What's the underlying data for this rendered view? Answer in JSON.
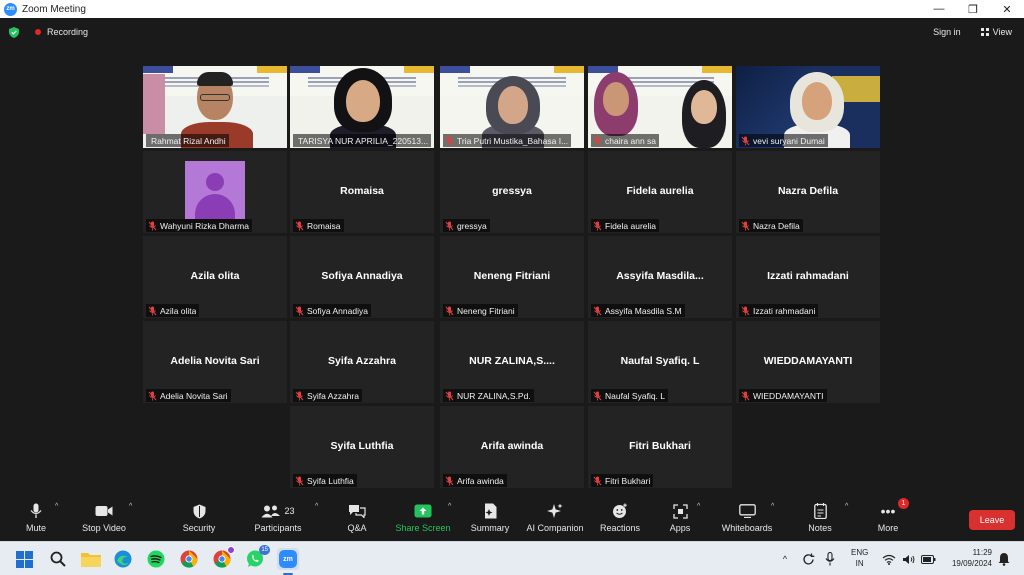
{
  "window": {
    "app_title": "Zoom Meeting",
    "minimize": "—",
    "maximize": "❐",
    "close": "✕"
  },
  "topbar": {
    "recording_label": "Recording",
    "sign_in_label": "Sign in",
    "view_label": "View"
  },
  "colors": {
    "accent_green": "#25c35e",
    "recording_red": "#e02828",
    "leave_red": "#d93030",
    "active_speaker": "#e9d94a",
    "avatar_purple": "#b478d6"
  },
  "participants": [
    {
      "display_name": "Rahmat Rizal Andhi",
      "video_on": true,
      "muted": false
    },
    {
      "display_name": "TARISYA NUR APRILIA_220513...",
      "video_on": true,
      "muted": false,
      "active_speaker": true
    },
    {
      "display_name": "Tria Putri Mustika_Bahasa I...",
      "video_on": true,
      "muted": true
    },
    {
      "display_name": "chaira ann sa",
      "video_on": true,
      "muted": true
    },
    {
      "display_name": "vevi suryani Dumai",
      "video_on": true,
      "muted": true
    },
    {
      "display_name": "Wahyuni Rizka Dharma",
      "video_on": false,
      "muted": true,
      "avatar": "person-avatar-icon"
    },
    {
      "center_name": "Romaisa",
      "display_name": "Romaisa",
      "video_on": false,
      "muted": true
    },
    {
      "center_name": "gressya",
      "display_name": "gressya",
      "video_on": false,
      "muted": true
    },
    {
      "center_name": "Fidela aurelia",
      "display_name": "Fidela aurelia",
      "video_on": false,
      "muted": true
    },
    {
      "center_name": "Nazra Defila",
      "display_name": "Nazra Defila",
      "video_on": false,
      "muted": true
    },
    {
      "center_name": "Azila olita",
      "display_name": "Azila olita",
      "video_on": false,
      "muted": true
    },
    {
      "center_name": "Sofiya Annadiya",
      "display_name": "Sofiya Annadiya",
      "video_on": false,
      "muted": true
    },
    {
      "center_name": "Neneng Fitriani",
      "display_name": "Neneng Fitriani",
      "video_on": false,
      "muted": true
    },
    {
      "center_name": "Assyifa  Masdila...",
      "display_name": "Assyifa Masdila S.M",
      "video_on": false,
      "muted": true
    },
    {
      "center_name": "Izzati rahmadani",
      "display_name": "Izzati rahmadani",
      "video_on": false,
      "muted": true
    },
    {
      "center_name": "Adelia Novita Sari",
      "display_name": "Adelia Novita Sari",
      "video_on": false,
      "muted": true
    },
    {
      "center_name": "Syifa Azzahra",
      "display_name": "Syifa Azzahra",
      "video_on": false,
      "muted": true
    },
    {
      "center_name": "NUR  ZALINA,S....",
      "display_name": "NUR ZALINA,S.Pd.",
      "video_on": false,
      "muted": true
    },
    {
      "center_name": "Naufal Syafiq. L",
      "display_name": "Naufal Syafiq. L",
      "video_on": false,
      "muted": true
    },
    {
      "center_name": "WIEDDAMAYANTI",
      "display_name": "WIEDDAMAYANTI",
      "video_on": false,
      "muted": true
    },
    {
      "center_name": "Syifa Luthfia",
      "display_name": "Syifa Luthfia",
      "video_on": false,
      "muted": true
    },
    {
      "center_name": "Arifa awinda",
      "display_name": "Arifa awinda",
      "video_on": false,
      "muted": true
    },
    {
      "center_name": "Fitri Bukhari",
      "display_name": "Fitri Bukhari",
      "video_on": false,
      "muted": true
    }
  ],
  "toolbar": {
    "mute_label": "Mute",
    "stop_video_label": "Stop Video",
    "security_label": "Security",
    "participants_label": "Participants",
    "participants_count": "23",
    "qa_label": "Q&A",
    "share_screen_label": "Share Screen",
    "summary_label": "Summary",
    "ai_companion_label": "AI Companion",
    "reactions_label": "Reactions",
    "apps_label": "Apps",
    "whiteboards_label": "Whiteboards",
    "notes_label": "Notes",
    "more_label": "More",
    "more_badge": "1",
    "leave_label": "Leave"
  },
  "taskbar": {
    "apps": [
      "start-icon",
      "search-icon",
      "file-explorer-icon",
      "edge-icon",
      "spotify-icon",
      "chrome-icon",
      "chrome-profile-icon",
      "whatsapp-icon",
      "zoom-icon"
    ],
    "whatsapp_badge": "15",
    "language_top": "ENG",
    "language_bottom": "IN",
    "time": "11:29",
    "date": "19/09/2024"
  }
}
